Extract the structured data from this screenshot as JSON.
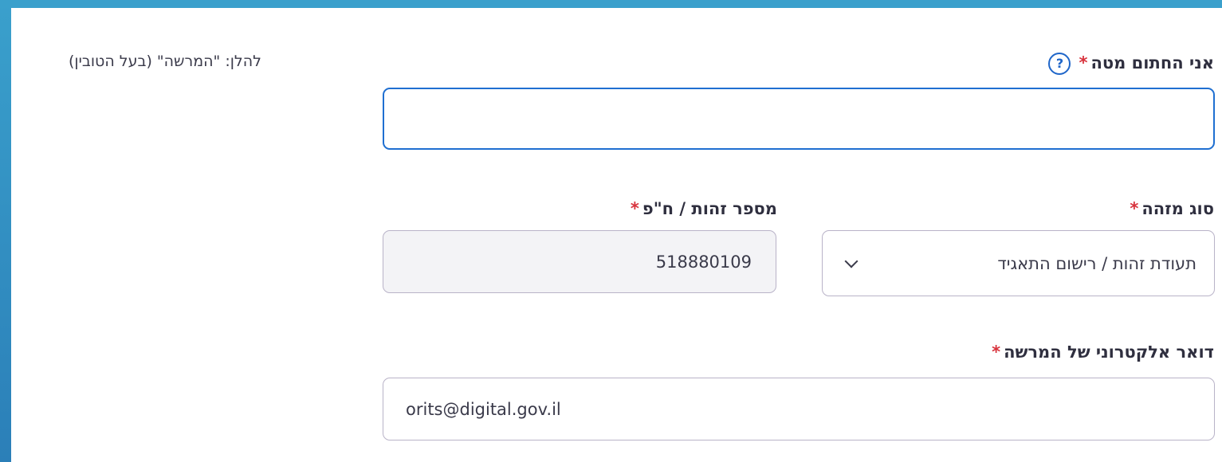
{
  "signer": {
    "label": "אני החתום מטה",
    "required_mark": "*",
    "help_icon": "?",
    "value": ""
  },
  "note": {
    "text": "להלן: \"המרשה\" (בעל הטובין)"
  },
  "id_type": {
    "label": "סוג מזהה",
    "required_mark": "*",
    "selected": "תעודת זהות / רישום התאגיד"
  },
  "id_number": {
    "label": "מספר זהות / ח\"פ",
    "required_mark": "*",
    "value": "518880109"
  },
  "email": {
    "label": "דואר אלקטרוני של המרשה",
    "required_mark": "*",
    "value": "orits@digital.gov.il"
  },
  "colors": {
    "background": "#3aa0cc",
    "focus_border": "#1f6fd1",
    "required": "#d8323c",
    "help_icon": "#1f66c9"
  }
}
